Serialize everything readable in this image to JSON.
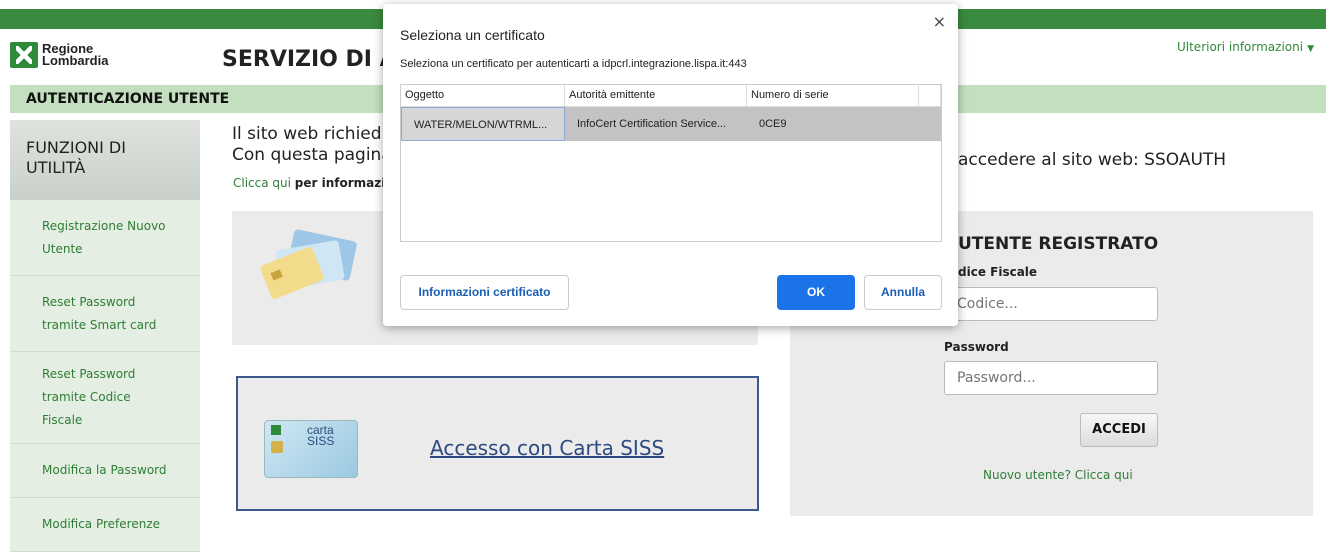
{
  "header": {
    "logo_line1": "Regione",
    "logo_line2": "Lombardia",
    "title": "SERVIZIO DI AU",
    "more_info": "Ulteriori informazioni",
    "more_info_icon": "chevron-down-icon"
  },
  "authbar": {
    "label": "AUTENTICAZIONE UTENTE"
  },
  "sidebar": {
    "heading_line1": "FUNZIONI DI",
    "heading_line2": "UTILITÀ",
    "items": [
      {
        "line1": "Registrazione Nuovo",
        "line2": "Utente",
        "line3": ""
      },
      {
        "line1": "Reset Password",
        "line2": "tramite Smart card",
        "line3": ""
      },
      {
        "line1": "Reset Password",
        "line2": "tramite Codice",
        "line3": "Fiscale"
      },
      {
        "line1": "Modifica la Password",
        "line2": "",
        "line3": ""
      },
      {
        "line1": "Modifica Preferenze",
        "line2": "",
        "line3": ""
      }
    ]
  },
  "main": {
    "intro_line1": "Il sito web richied",
    "intro_line2": "Con questa pagina",
    "link_text": "Clicca qui",
    "link_rest": "per informazi",
    "siss_card_word1": "carta",
    "siss_card_word2": "SISS",
    "siss_link": "Accesso con Carta SISS",
    "site_web": "accedere al sito web: SSOAUTH"
  },
  "login": {
    "title": "UTENTE REGISTRATO",
    "codice_label": "dice Fiscale",
    "codice_placeholder": "Codice...",
    "password_label": "Password",
    "password_placeholder": "Password...",
    "submit": "ACCEDI",
    "new_user": "Nuovo utente? Clicca qui"
  },
  "dialog": {
    "title": "Seleziona un certificato",
    "close": "×",
    "subtitle": "Seleziona un certificato per autenticarti a idpcrl.integrazione.lispa.it:443",
    "columns": [
      "Oggetto",
      "Autorità emittente",
      "Numero di serie"
    ],
    "rows": [
      {
        "subject": "WATER/MELON/WTRML...",
        "issuer": "InfoCert Certification Service...",
        "serial": "0CE9"
      }
    ],
    "info_button": "Informazioni certificato",
    "ok_button": "OK",
    "cancel_button": "Annulla"
  },
  "colors": {
    "brand_green": "#3a8a3f",
    "link_green": "#2f7d36",
    "primary_blue": "#1a73e8"
  }
}
